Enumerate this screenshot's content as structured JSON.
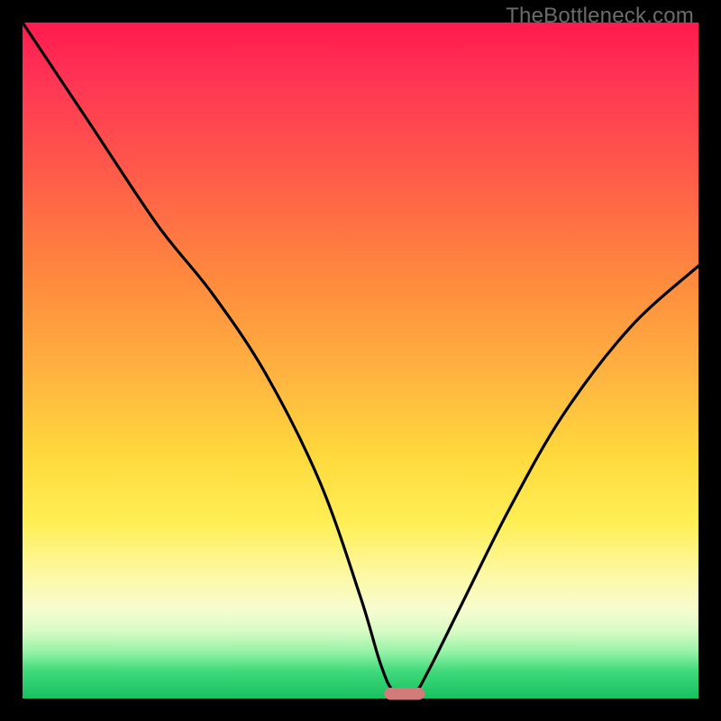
{
  "watermark": "TheBottleneck.com",
  "chart_data": {
    "type": "line",
    "title": "",
    "xlabel": "",
    "ylabel": "",
    "xlim": [
      0,
      100
    ],
    "ylim": [
      0,
      100
    ],
    "grid": false,
    "legend": false,
    "series": [
      {
        "name": "bottleneck-curve",
        "x": [
          0,
          10,
          20,
          28,
          36,
          44,
          50,
          53,
          55,
          58,
          60,
          65,
          72,
          80,
          90,
          100
        ],
        "y": [
          100,
          85,
          70,
          60,
          48,
          32,
          15,
          5,
          1,
          1,
          4,
          14,
          28,
          42,
          55,
          64
        ]
      }
    ],
    "marker": {
      "x_center": 56.5,
      "y": 0.7,
      "width": 6,
      "height": 1.8,
      "color": "#d47a7a"
    },
    "background_gradient": {
      "stops": [
        {
          "pct": 0,
          "color": "#ff1a4d"
        },
        {
          "pct": 22,
          "color": "#ff5a4a"
        },
        {
          "pct": 52,
          "color": "#ffb340"
        },
        {
          "pct": 74,
          "color": "#ffef55"
        },
        {
          "pct": 90,
          "color": "#d8fbc6"
        },
        {
          "pct": 100,
          "color": "#18c060"
        }
      ]
    }
  }
}
